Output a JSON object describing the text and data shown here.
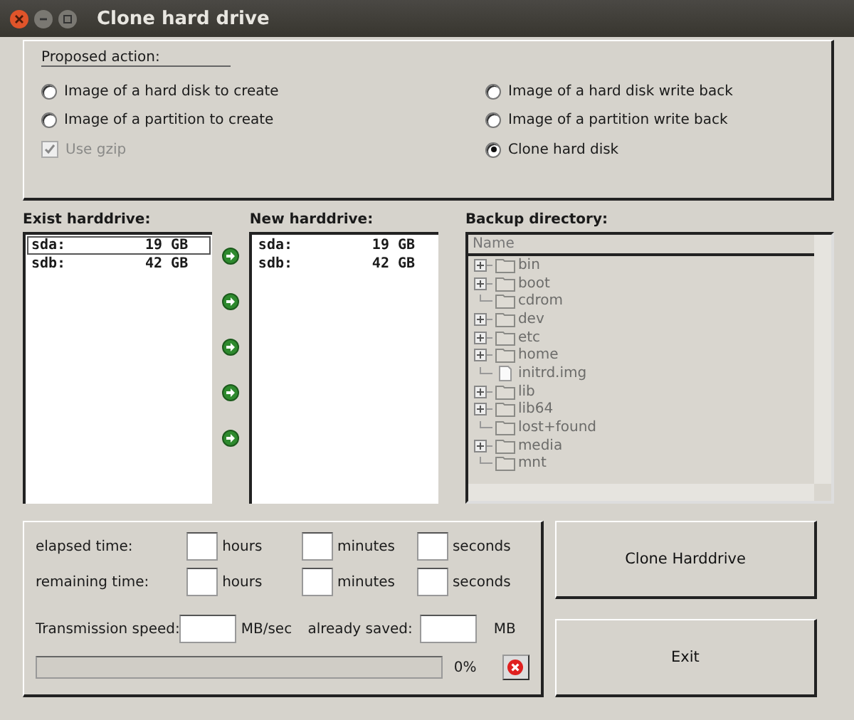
{
  "window": {
    "title": "Clone hard drive"
  },
  "proposed_action": {
    "legend": "Proposed action:",
    "options": [
      {
        "label": "Image of a hard disk to create",
        "kind": "radio",
        "selected": false
      },
      {
        "label": "Image of a hard disk write back",
        "kind": "radio",
        "selected": false
      },
      {
        "label": "Image of a partition to create",
        "kind": "radio",
        "selected": false
      },
      {
        "label": "Image of a partition write back",
        "kind": "radio",
        "selected": false
      },
      {
        "label": "Use gzip",
        "kind": "checkbox",
        "checked": true,
        "disabled": true
      },
      {
        "label": "Clone hard disk",
        "kind": "radio",
        "selected": true
      }
    ]
  },
  "exist_harddrive": {
    "label": "Exist harddrive:",
    "items": [
      {
        "name": "sda:",
        "size": "19 GB",
        "selected": true
      },
      {
        "name": "sdb:",
        "size": "42 GB",
        "selected": false
      }
    ]
  },
  "new_harddrive": {
    "label": "New harddrive:",
    "items": [
      {
        "name": "sda:",
        "size": "19 GB",
        "selected": false
      },
      {
        "name": "sdb:",
        "size": "42 GB",
        "selected": false
      }
    ]
  },
  "backup_directory": {
    "label": "Backup directory:",
    "column": "Name",
    "items": [
      {
        "name": "bin",
        "kind": "folder",
        "expandable": true
      },
      {
        "name": "boot",
        "kind": "folder",
        "expandable": true
      },
      {
        "name": "cdrom",
        "kind": "folder",
        "expandable": false
      },
      {
        "name": "dev",
        "kind": "folder",
        "expandable": true
      },
      {
        "name": "etc",
        "kind": "folder",
        "expandable": true
      },
      {
        "name": "home",
        "kind": "folder",
        "expandable": true
      },
      {
        "name": "initrd.img",
        "kind": "file",
        "expandable": false
      },
      {
        "name": "lib",
        "kind": "folder",
        "expandable": true
      },
      {
        "name": "lib64",
        "kind": "folder",
        "expandable": true
      },
      {
        "name": "lost+found",
        "kind": "folder",
        "expandable": false
      },
      {
        "name": "media",
        "kind": "folder",
        "expandable": true
      },
      {
        "name": "mnt",
        "kind": "folder",
        "expandable": false
      }
    ]
  },
  "timing": {
    "rows": [
      {
        "label": "elapsed time:",
        "units": [
          "hours",
          "minutes",
          "seconds"
        ]
      },
      {
        "label": "remaining time:",
        "units": [
          "hours",
          "minutes",
          "seconds"
        ]
      }
    ],
    "speed_label": "Transmission speed:",
    "speed_unit": "MB/sec",
    "saved_label": "already saved:",
    "saved_unit": "MB",
    "progress": {
      "level": 0,
      "reading": "0%"
    }
  },
  "buttons": [
    "Clone Harddrive",
    "Exit"
  ]
}
